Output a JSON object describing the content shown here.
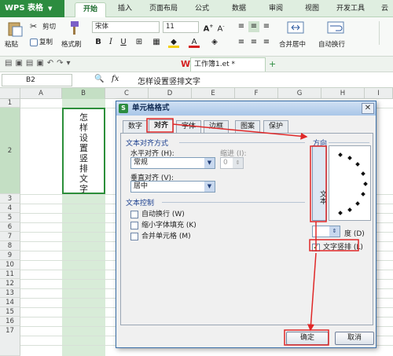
{
  "app": {
    "name": "WPS 表格",
    "tabs": [
      "开始",
      "插入",
      "页面布局",
      "公式",
      "数据",
      "审阅",
      "视图",
      "开发工具",
      "云"
    ],
    "active_tab": "开始"
  },
  "ribbon": {
    "paste": "粘贴",
    "cut": "剪切",
    "copy": "复制",
    "format_painter": "格式刷",
    "font": "宋体",
    "size": "11",
    "merge": "合并居中",
    "wrap": "自动换行"
  },
  "doc_tab": "工作簿1.et *",
  "formula": {
    "cell": "B2",
    "fx": "fx",
    "content": "怎样设置竖排文字"
  },
  "columns": [
    "A",
    "B",
    "C",
    "D",
    "E",
    "F",
    "G",
    "H",
    "I"
  ],
  "rows": [
    "1",
    "2",
    "3",
    "4",
    "5",
    "6",
    "7",
    "8",
    "9",
    "10",
    "11",
    "12",
    "13",
    "14",
    "15",
    "16",
    "17"
  ],
  "cell_b2": [
    "怎",
    "样",
    "设",
    "置",
    "竖",
    "排",
    "文",
    "字"
  ],
  "dialog": {
    "title": "单元格格式",
    "tabs": [
      "数字",
      "对齐",
      "字体",
      "边框",
      "图案",
      "保护"
    ],
    "active_tab": "对齐",
    "text_align_section": "文本对齐方式",
    "halign_label": "水平对齐 (H):",
    "halign_value": "常规",
    "indent_label": "缩进 (I):",
    "indent_value": "0",
    "valign_label": "垂直对齐 (V):",
    "valign_value": "居中",
    "text_control_section": "文本控制",
    "wrap_label": "自动换行 (W)",
    "shrink_label": "缩小字体填充 (K)",
    "merge_label": "合并单元格 (M)",
    "orientation_section": "方向",
    "vertical_text_button": "文本",
    "degree_label": "度 (D)",
    "vertical_text_label": "文字竖排 (L)",
    "vertical_text_checked": true,
    "ok": "确定",
    "cancel": "取消"
  },
  "colors": {
    "accent": "#2c8c3f",
    "annotation": "#e02828",
    "selection": "#d8ecd8"
  }
}
